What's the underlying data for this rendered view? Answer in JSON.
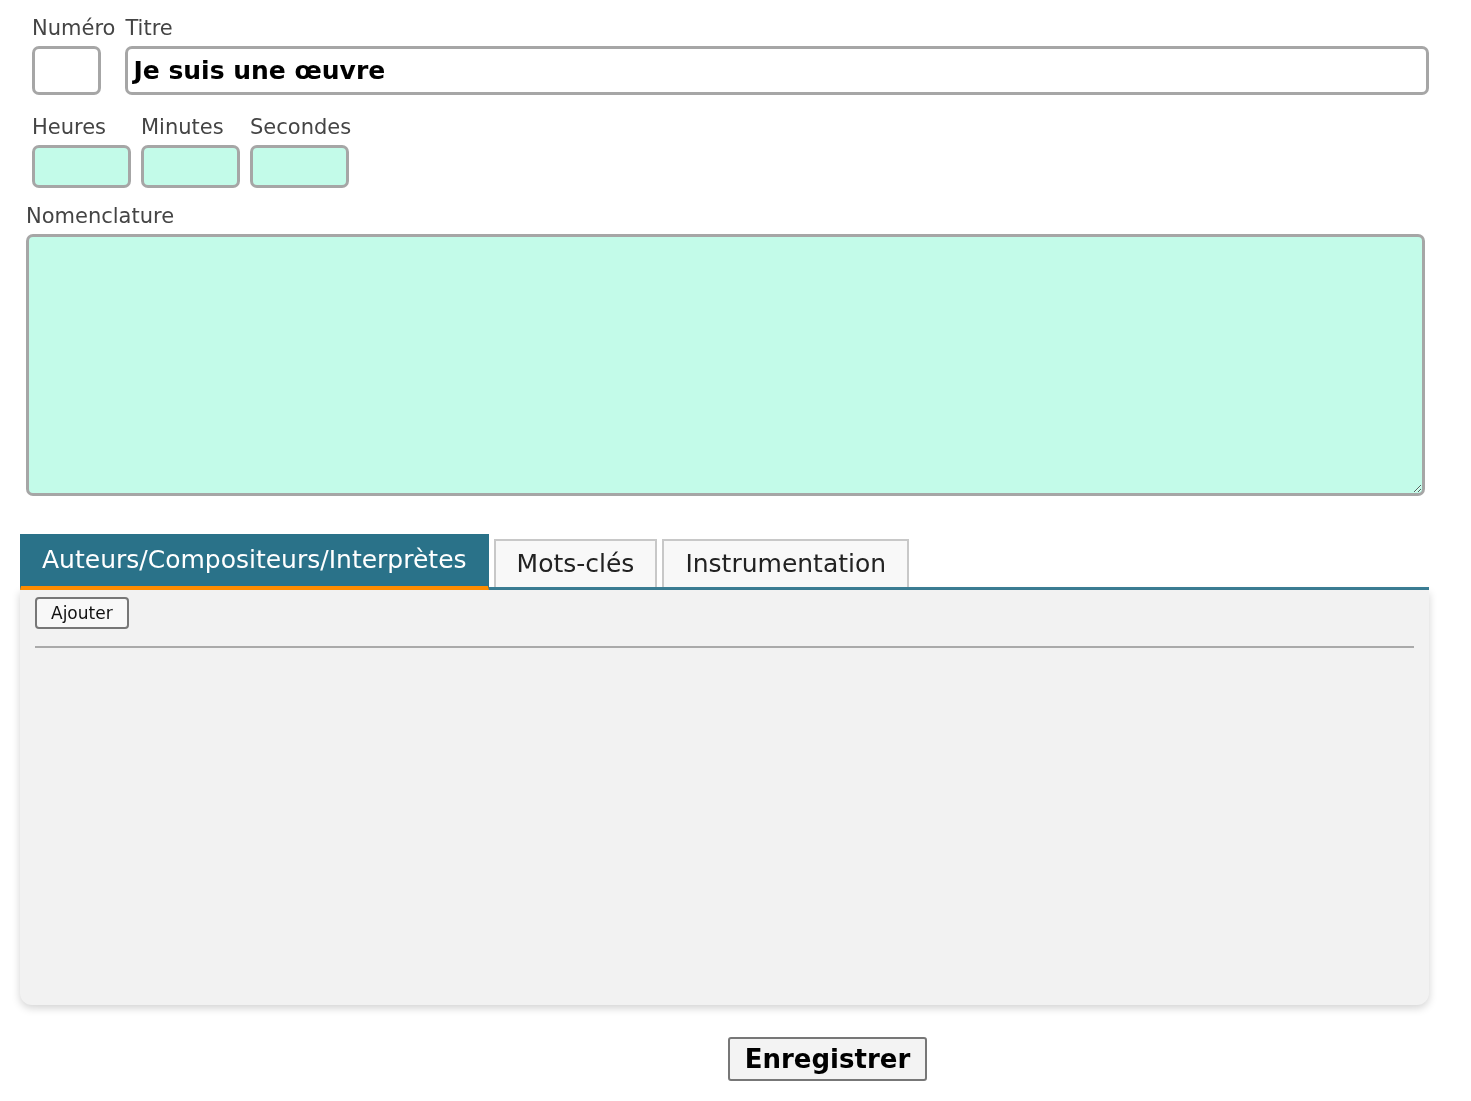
{
  "fields_row_1": [
    {
      "label": "Numéro",
      "kind": "short"
    },
    {
      "label": "Titre",
      "value": "Je suis une œuvre",
      "kind": "wide"
    }
  ],
  "duration": [
    {
      "label": "Heures"
    },
    {
      "label": "Minutes"
    },
    {
      "label": "Secondes"
    }
  ],
  "nomenclature": {
    "label": "Nomenclature"
  },
  "tabs": [
    {
      "label": "Auteurs/Compositeurs/Interprètes",
      "selected": true
    },
    {
      "label": "Mots-clés",
      "selected": false
    },
    {
      "label": "Instrumentation",
      "selected": false
    }
  ],
  "panel": {
    "button": "Ajouter"
  },
  "submit": "Enregistrer"
}
